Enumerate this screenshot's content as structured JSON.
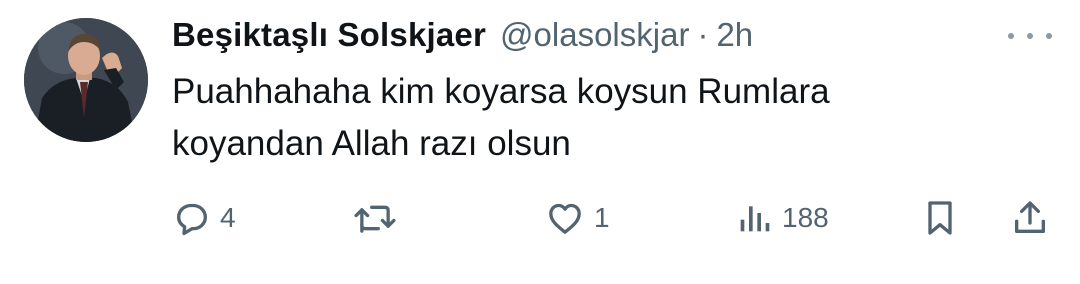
{
  "tweet": {
    "author": {
      "display_name": "Beşiktaşlı Solskjaer",
      "handle": "@olasolskjar",
      "separator": "·",
      "time": "2h"
    },
    "text_line1": "Puahhahaha kim koyarsa koysun Rumlara",
    "text_line2": "koyandan Allah razı olsun",
    "actions": {
      "reply_count": "4",
      "retweet_count": "",
      "like_count": "1",
      "views_count": "188"
    },
    "icons": {
      "reply": "reply-icon",
      "retweet": "retweet-icon",
      "like": "heart-icon",
      "views": "views-icon",
      "bookmark": "bookmark-icon",
      "share": "share-icon",
      "more": "more-icon"
    },
    "colors": {
      "text": "#0f1419",
      "secondary": "#536471"
    }
  }
}
